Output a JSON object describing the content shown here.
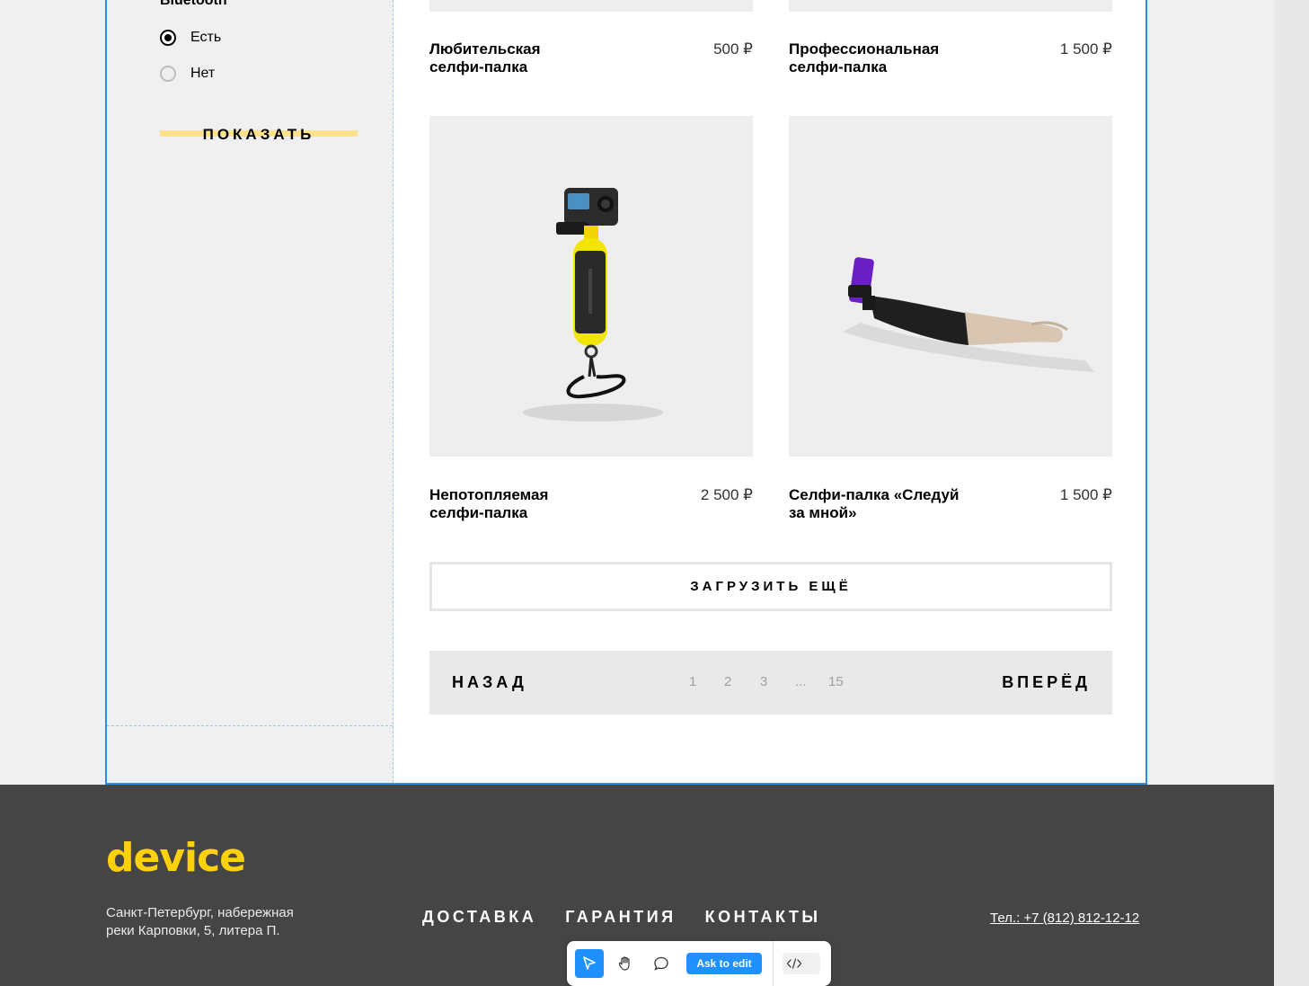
{
  "filter": {
    "title": "Bluetooth",
    "options": [
      {
        "label": "Есть",
        "checked": true
      },
      {
        "label": "Нет",
        "checked": false
      }
    ],
    "show_button": "ПОКАЗАТЬ"
  },
  "products": [
    {
      "title_line1": "Любительская",
      "title_line2": "селфи-палка",
      "price": "500 ₽"
    },
    {
      "title_line1": "Профессиональная",
      "title_line2": "селфи-палка",
      "price": "1 500 ₽"
    },
    {
      "title_line1": "Непотопляемая",
      "title_line2": "селфи-палка",
      "price": "2 500 ₽",
      "image": "floating-camera-stick"
    },
    {
      "title_line1": "Селфи-палка «Следуй",
      "title_line2": "за мной»",
      "price": "1 500 ₽",
      "image": "follow-me-stick"
    }
  ],
  "load_more": "ЗАГРУЗИТЬ ЕЩЁ",
  "pagination": {
    "back": "НАЗАД",
    "next": "ВПЕРЁД",
    "pages": [
      "1",
      "2",
      "3",
      "...",
      "15"
    ]
  },
  "footer": {
    "logo": "device",
    "address_line1": "Санкт-Петербург, набережная",
    "address_line2": "реки Карповки, 5, литера П.",
    "nav": [
      "ДОСТАВКА",
      "ГАРАНТИЯ",
      "КОНТАКТЫ"
    ],
    "phone": "Тел.: +7 (812) 812-12-12"
  },
  "toolbar": {
    "ask_to_edit": "Ask to edit",
    "tools": [
      "pointer-icon",
      "hand-icon",
      "comment-icon",
      "code-icon"
    ]
  },
  "colors": {
    "accent_yellow": "#ffd10b",
    "button_highlight": "#ffe28a",
    "selection_blue": "#2b8ee0",
    "footer_bg": "#454545",
    "toolbar_blue": "#1e90ff"
  }
}
